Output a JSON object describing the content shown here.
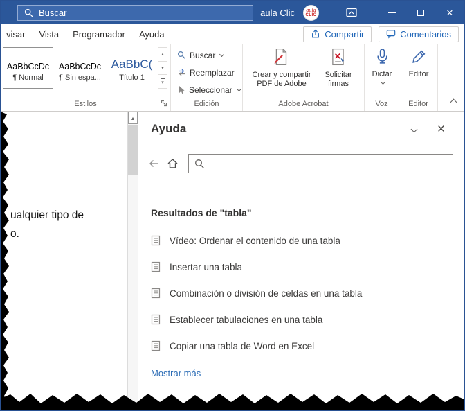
{
  "colors": {
    "titlebar_blue": "#2b579a",
    "accent_blue": "#1f66b8",
    "link_blue": "#2b6cb5"
  },
  "titlebar": {
    "search_label": "Buscar",
    "account": "aula Clic",
    "logo_line1": "aula",
    "logo_line2": "CLIC"
  },
  "tabs": {
    "items": [
      "visar",
      "Vista",
      "Programador",
      "Ayuda"
    ],
    "share": "Compartir",
    "comments": "Comentarios"
  },
  "ribbon": {
    "styles": {
      "cards": [
        {
          "preview": "AaBbCcDc",
          "name": "¶ Normal"
        },
        {
          "preview": "AaBbCcDc",
          "name": "¶ Sin espa..."
        },
        {
          "preview": "AaBbC(",
          "name": "Título 1"
        }
      ],
      "label": "Estilos"
    },
    "edicion": {
      "find": "Buscar",
      "replace": "Reemplazar",
      "select": "Seleccionar",
      "label": "Edición"
    },
    "adobe": {
      "create_line1": "Crear y compartir",
      "create_line2": "PDF de Adobe",
      "sign_line1": "Solicitar",
      "sign_line2": "firmas",
      "label": "Adobe Acrobat"
    },
    "voz": {
      "dictate": "Dictar",
      "label": "Voz"
    },
    "editor": {
      "editor": "Editor",
      "label": "Editor"
    }
  },
  "document": {
    "line1": "ualquier tipo de",
    "line2": "o."
  },
  "help": {
    "title": "Ayuda",
    "results_heading": "Resultados de \"tabla\"",
    "results": [
      "Vídeo: Ordenar el contenido de una tabla",
      "Insertar una tabla",
      "Combinación o división de celdas en una tabla",
      "Establecer tabulaciones en una tabla",
      "Copiar una tabla de Word en Excel"
    ],
    "show_more": "Mostrar más"
  }
}
